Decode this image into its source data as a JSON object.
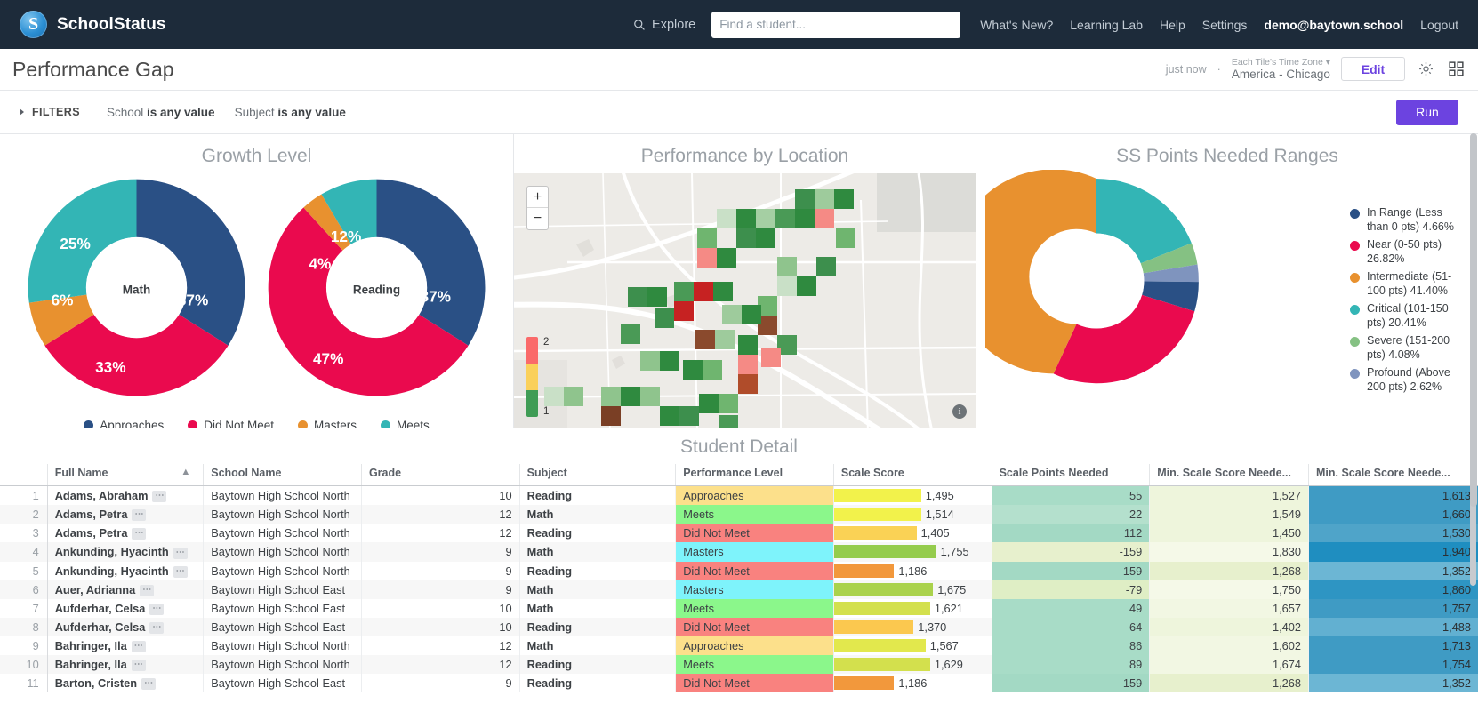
{
  "topnav": {
    "brand": "SchoolStatus",
    "brand_mark": "S",
    "explore": "Explore",
    "search_placeholder": "Find a student...",
    "search_value": "",
    "links": [
      {
        "label": "What's New?",
        "strong": false
      },
      {
        "label": "Learning Lab",
        "strong": false
      },
      {
        "label": "Help",
        "strong": false
      },
      {
        "label": "Settings",
        "strong": false
      },
      {
        "label": "demo@baytown.school",
        "strong": true
      },
      {
        "label": "Logout",
        "strong": false
      }
    ]
  },
  "titlebar": {
    "title": "Performance Gap",
    "just_now": "just now",
    "separator": "·",
    "tz_label": "Each Tile's Time Zone",
    "tz_value": "America - Chicago",
    "edit": "Edit"
  },
  "filterbar": {
    "filters_label": "FILTERS",
    "chips": [
      {
        "field": "School",
        "value": "is any value"
      },
      {
        "field": "Subject",
        "value": "is any value"
      }
    ],
    "run": "Run"
  },
  "colors": {
    "approaches": "#2a5085",
    "did_not_meet": "#ea0a4e",
    "masters": "#e8912f",
    "meets": "#33b5b5",
    "severe": "#85c183",
    "profound": "#7f94be",
    "accent": "#6c43e0",
    "navbar": "#1d2b3a"
  },
  "tiles": {
    "growth": {
      "title": "Growth Level",
      "legend": [
        {
          "label": "Approaches",
          "color": "#2a5085"
        },
        {
          "label": "Did Not Meet",
          "color": "#ea0a4e"
        },
        {
          "label": "Masters",
          "color": "#e8912f"
        },
        {
          "label": "Meets",
          "color": "#33b5b5"
        }
      ]
    },
    "map": {
      "title": "Performance by Location",
      "zoom_in": "+",
      "zoom_out": "−",
      "legend_max": "2",
      "legend_min": "1",
      "info": "i"
    },
    "ss": {
      "title": "SS Points Needed Ranges"
    }
  },
  "chart_data": [
    {
      "type": "pie",
      "title": "Growth Level — Math",
      "center_label": "Math",
      "categories": [
        "Approaches",
        "Did Not Meet",
        "Masters",
        "Meets"
      ],
      "values": [
        37,
        33,
        6,
        25
      ],
      "value_labels": [
        "37%",
        "33%",
        "6%",
        "25%"
      ],
      "colors": [
        "#2a5085",
        "#ea0a4e",
        "#e8912f",
        "#33b5b5"
      ],
      "legend_position": "bottom",
      "donut": true
    },
    {
      "type": "pie",
      "title": "Growth Level — Reading",
      "center_label": "Reading",
      "categories": [
        "Approaches",
        "Did Not Meet",
        "Masters",
        "Meets"
      ],
      "values": [
        37,
        47,
        4,
        12
      ],
      "value_labels": [
        "37%",
        "47%",
        "4%",
        "12%"
      ],
      "colors": [
        "#2a5085",
        "#ea0a4e",
        "#e8912f",
        "#33b5b5"
      ],
      "legend_position": "bottom",
      "donut": true
    },
    {
      "type": "pie",
      "title": "SS Points Needed Ranges",
      "categories": [
        "Critical (101-150 pts)",
        "Severe (151-200 pts)",
        "Profound (Above 200 pts)",
        "In Range (Less than 0 pts)",
        "Near (0-50 pts)",
        "Intermediate (51-100 pts)"
      ],
      "values": [
        20.41,
        4.08,
        2.62,
        4.66,
        26.82,
        41.4
      ],
      "colors": [
        "#33b5b5",
        "#85c183",
        "#7f94be",
        "#2a5085",
        "#ea0a4e",
        "#e8912f"
      ],
      "legend_position": "right",
      "donut": true,
      "legend_entries": [
        {
          "label": "In Range (Less than 0 pts) 4.66%",
          "color": "#2a5085"
        },
        {
          "label": "Near (0-50 pts) 26.82%",
          "color": "#ea0a4e"
        },
        {
          "label": "Intermediate (51-100 pts) 41.40%",
          "color": "#e8912f"
        },
        {
          "label": "Critical (101-150 pts) 20.41%",
          "color": "#33b5b5"
        },
        {
          "label": "Severe (151-200 pts) 4.08%",
          "color": "#85c183"
        },
        {
          "label": "Profound (Above 200 pts) 2.62%",
          "color": "#7f94be"
        }
      ]
    }
  ],
  "student_detail": {
    "title": "Student Detail",
    "columns": [
      "Full Name",
      "School Name",
      "Grade",
      "Subject",
      "Performance Level",
      "Scale Score",
      "Scale Points Needed",
      "Min. Scale Score Neede...",
      "Min. Scale Score Neede..."
    ],
    "sort_column": "Full Name",
    "sort_dir": "asc",
    "rows": [
      {
        "idx": "1",
        "name": "Adams, Abraham",
        "school": "Baytown High School North",
        "grade": "10",
        "subject": "Reading",
        "level": "Approaches",
        "score": "1,495",
        "score_pct": 58,
        "score_color": "#f2f24b",
        "points": "55",
        "points_bg": "#a8dcc7",
        "min1": "1,527",
        "min1_bg": "#eef5dc",
        "min2": "1,613",
        "min2_bg": "#3f9bc4"
      },
      {
        "idx": "2",
        "name": "Adams, Petra",
        "school": "Baytown High School North",
        "grade": "12",
        "subject": "Math",
        "level": "Meets",
        "score": "1,514",
        "score_pct": 58,
        "score_color": "#f2f24b",
        "points": "22",
        "points_bg": "#b4e0cd",
        "min1": "1,549",
        "min1_bg": "#eef5dc",
        "min2": "1,660",
        "min2_bg": "#3f9bc4"
      },
      {
        "idx": "3",
        "name": "Adams, Petra",
        "school": "Baytown High School North",
        "grade": "12",
        "subject": "Reading",
        "level": "Did Not Meet",
        "score": "1,405",
        "score_pct": 55,
        "score_color": "#fad255",
        "points": "112",
        "points_bg": "#a3d9c4",
        "min1": "1,450",
        "min1_bg": "#eef5dc",
        "min2": "1,530",
        "min2_bg": "#4fa4c9"
      },
      {
        "idx": "4",
        "name": "Ankunding, Hyacinth",
        "school": "Baytown High School North",
        "grade": "9",
        "subject": "Math",
        "level": "Masters",
        "score": "1,755",
        "score_pct": 68,
        "score_color": "#95cc4d",
        "points": "-159",
        "points_bg": "#e7f0cd",
        "min1": "1,830",
        "min1_bg": "#f5f9e8",
        "min2": "1,940",
        "min2_bg": "#1f8ec0"
      },
      {
        "idx": "5",
        "name": "Ankunding, Hyacinth",
        "school": "Baytown High School North",
        "grade": "9",
        "subject": "Reading",
        "level": "Did Not Meet",
        "score": "1,186",
        "score_pct": 40,
        "score_color": "#f2983c",
        "points": "159",
        "points_bg": "#a3d9c4",
        "min1": "1,268",
        "min1_bg": "#e7f0cd",
        "min2": "1,352",
        "min2_bg": "#6cb6d4"
      },
      {
        "idx": "6",
        "name": "Auer, Adrianna",
        "school": "Baytown High School East",
        "grade": "9",
        "subject": "Math",
        "level": "Masters",
        "score": "1,675",
        "score_pct": 66,
        "score_color": "#aad24c",
        "points": "-79",
        "points_bg": "#dfeec5",
        "min1": "1,750",
        "min1_bg": "#f5f9e8",
        "min2": "1,860",
        "min2_bg": "#2e95c3"
      },
      {
        "idx": "7",
        "name": "Aufderhar, Celsa",
        "school": "Baytown High School East",
        "grade": "10",
        "subject": "Math",
        "level": "Meets",
        "score": "1,621",
        "score_pct": 64,
        "score_color": "#d3e04d",
        "points": "49",
        "points_bg": "#a8dcc7",
        "min1": "1,657",
        "min1_bg": "#f2f7e3",
        "min2": "1,757",
        "min2_bg": "#3f9bc4"
      },
      {
        "idx": "8",
        "name": "Aufderhar, Celsa",
        "school": "Baytown High School East",
        "grade": "10",
        "subject": "Reading",
        "level": "Did Not Meet",
        "score": "1,370",
        "score_pct": 53,
        "score_color": "#fbc84f",
        "points": "64",
        "points_bg": "#a8dcc7",
        "min1": "1,402",
        "min1_bg": "#eef5dc",
        "min2": "1,488",
        "min2_bg": "#62b0d1"
      },
      {
        "idx": "9",
        "name": "Bahringer, Ila",
        "school": "Baytown High School North",
        "grade": "12",
        "subject": "Math",
        "level": "Approaches",
        "score": "1,567",
        "score_pct": 61,
        "score_color": "#e2e84d",
        "points": "86",
        "points_bg": "#a8dcc7",
        "min1": "1,602",
        "min1_bg": "#f2f7e3",
        "min2": "1,713",
        "min2_bg": "#3f9bc4"
      },
      {
        "idx": "10",
        "name": "Bahringer, Ila",
        "school": "Baytown High School North",
        "grade": "12",
        "subject": "Reading",
        "level": "Meets",
        "score": "1,629",
        "score_pct": 64,
        "score_color": "#d3e04d",
        "points": "89",
        "points_bg": "#a8dcc7",
        "min1": "1,674",
        "min1_bg": "#f2f7e3",
        "min2": "1,754",
        "min2_bg": "#3f9bc4"
      },
      {
        "idx": "11",
        "name": "Barton, Cristen",
        "school": "Baytown High School East",
        "grade": "9",
        "subject": "Reading",
        "level": "Did Not Meet",
        "score": "1,186",
        "score_pct": 40,
        "score_color": "#f2983c",
        "points": "159",
        "points_bg": "#a3d9c4",
        "min1": "1,268",
        "min1_bg": "#e7f0cd",
        "min2": "1,352",
        "min2_bg": "#6cb6d4"
      }
    ],
    "level_colors": {
      "Approaches": "#fce08b",
      "Meets": "#8bf78b",
      "Did Not Meet": "#f9827f",
      "Masters": "#7ef3fb"
    }
  }
}
